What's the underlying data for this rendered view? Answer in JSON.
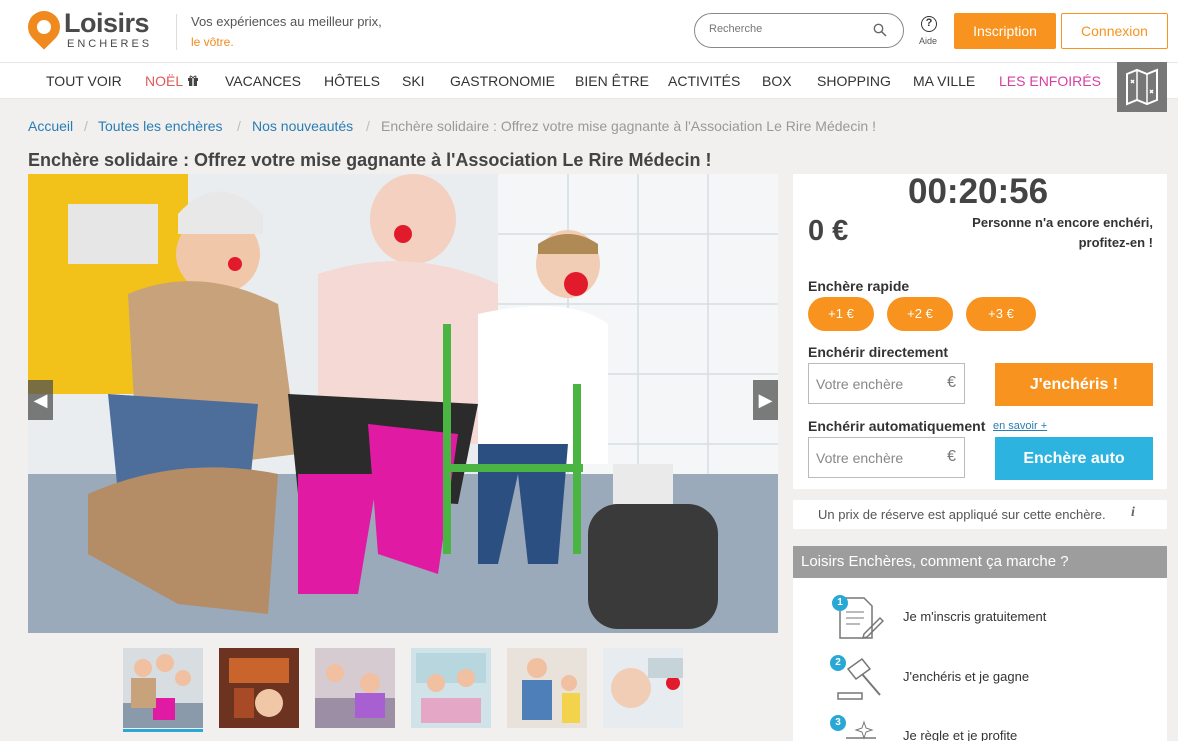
{
  "header": {
    "logo_name": "Loisirs",
    "logo_sub": "ENCHERES",
    "tagline_line1": "Vos expériences au meilleur prix,",
    "tagline_line2": "le vôtre.",
    "search_placeholder": "Recherche",
    "help_label": "Aide",
    "signup_label": "Inscription",
    "login_label": "Connexion"
  },
  "nav": {
    "items": [
      "TOUT VOIR",
      "NOËL",
      "VACANCES",
      "HÔTELS",
      "SKI",
      "GASTRONOMIE",
      "BIEN ÊTRE",
      "ACTIVITÉS",
      "BOX",
      "SHOPPING",
      "MA VILLE",
      "LES ENFOIRÉS"
    ],
    "colors": {
      "default": "#333333",
      "noel": "#e05a5a",
      "enfoires": "#d63fa0"
    }
  },
  "breadcrumb": [
    "Accueil",
    "Toutes les enchères",
    "Nos nouveautés",
    "Enchère solidaire : Offrez votre mise gagnante à l'Association Le Rire Médecin !"
  ],
  "title": "Enchère solidaire : Offrez votre mise gagnante à l'Association Le Rire Médecin !",
  "auction": {
    "timer": "00:20:56",
    "price": "0 €",
    "no_bid_line1": "Personne n'a encore enchéri,",
    "no_bid_line2": "profitez-en !",
    "quick_bid_label": "Enchère rapide",
    "quick_bids": [
      "+1 €",
      "+2 €",
      "+3 €"
    ],
    "direct_label": "Enchérir directement",
    "direct_placeholder": "Votre enchère",
    "currency": "€",
    "bid_button": "J'enchéris !",
    "auto_label": "Enchérir automatiquement",
    "learn_more": "en savoir +",
    "auto_placeholder": "Votre enchère",
    "auto_button": "Enchère auto",
    "reserve_text": "Un prix de réserve est appliqué sur cette enchère.",
    "reserve_icon": "i"
  },
  "how": {
    "title": "Loisirs Enchères, comment ça marche ?",
    "steps": [
      {
        "num": "1",
        "text": "Je m'inscris gratuitement"
      },
      {
        "num": "2",
        "text": "J'enchéris et je gagne"
      },
      {
        "num": "3",
        "text": "Je règle et je profite"
      }
    ]
  },
  "colors": {
    "accent": "#f7931e",
    "blue": "#2cb3e0",
    "link": "#2a7db4"
  }
}
